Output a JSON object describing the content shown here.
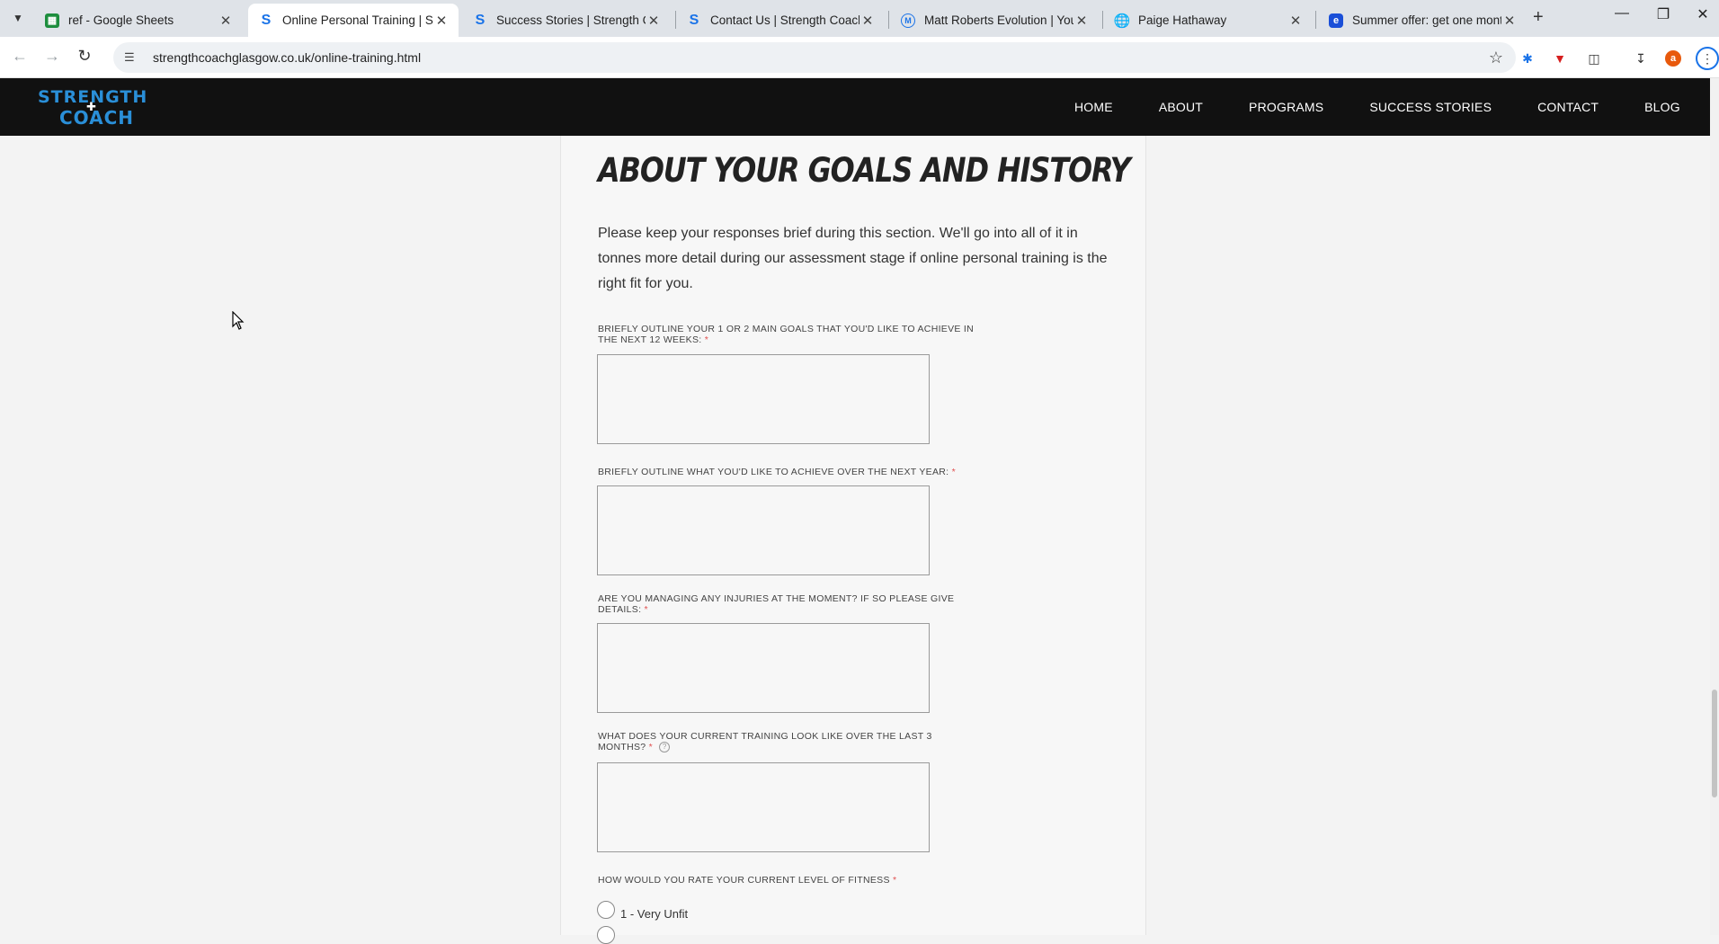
{
  "browser": {
    "tabs": [
      {
        "title": "ref - Google Sheets",
        "favicon": "sheets-icon",
        "color": "#1e8e3e",
        "active": false
      },
      {
        "title": "Online Personal Training | Stren",
        "favicon": "strength-coach-icon",
        "color": "#1a73e8",
        "active": true
      },
      {
        "title": "Success Stories | Strength Coac",
        "favicon": "strength-coach-icon",
        "color": "#1a73e8",
        "active": false
      },
      {
        "title": "Contact Us | Strength Coach Gl",
        "favicon": "strength-coach-icon",
        "color": "#1a73e8",
        "active": false
      },
      {
        "title": "Matt Roberts Evolution | Young",
        "favicon": "matt-roberts-icon",
        "color": "#1a73e8",
        "active": false
      },
      {
        "title": "Paige Hathaway",
        "favicon": "globe-icon",
        "color": "#5f6368",
        "active": false
      },
      {
        "title": "Summer offer: get one month f",
        "favicon": "offer-icon",
        "color": "#1a4fd8",
        "active": false
      }
    ],
    "url": "strengthcoachglasgow.co.uk/online-training.html"
  },
  "site": {
    "logo_line1": "STRENGTH",
    "logo_line2": "COACH",
    "nav": [
      "HOME",
      "ABOUT",
      "PROGRAMS",
      "SUCCESS STORIES",
      "CONTACT",
      "BLOG"
    ]
  },
  "section": {
    "heading": "ABOUT YOUR GOALS AND HISTORY",
    "intro": "Please keep your responses brief during this section. We'll go into all of it in tonnes more detail during our assessment stage if online personal training is the right fit for you."
  },
  "fields": [
    {
      "label": "BRIEFLY OUTLINE YOUR 1 OR 2 MAIN GOALS THAT YOU'D LIKE TO ACHIEVE IN THE NEXT 12 WEEKS:",
      "required": "*",
      "value": ""
    },
    {
      "label": "BRIEFLY OUTLINE WHAT YOU'D LIKE TO ACHIEVE OVER THE NEXT YEAR:",
      "required": "*",
      "value": ""
    },
    {
      "label": "ARE YOU MANAGING ANY INJURIES AT THE MOMENT? IF SO PLEASE GIVE DETAILS:",
      "required": "*",
      "value": ""
    },
    {
      "label": "WHAT DOES YOUR CURRENT TRAINING LOOK LIKE OVER THE LAST 3 MONTHS?",
      "required": "*",
      "value": ""
    }
  ],
  "fitness": {
    "label": "HOW WOULD YOU RATE YOUR CURRENT LEVEL OF FITNESS",
    "required": "*",
    "options": [
      "1 - Very Unfit"
    ]
  },
  "colors": {
    "header_bg": "#111111",
    "logo_blue": "#2a8fd8",
    "required_red": "#e05050"
  }
}
